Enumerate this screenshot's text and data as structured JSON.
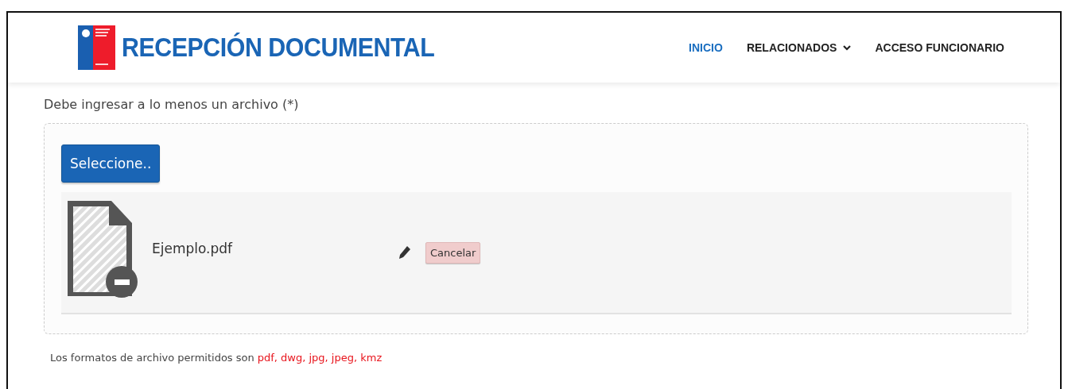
{
  "header": {
    "title": "RECEPCIÓN DOCUMENTAL",
    "nav": [
      {
        "label": "INICIO",
        "selected": true,
        "dropdown": false
      },
      {
        "label": "RELACIONADOS",
        "selected": false,
        "dropdown": true
      },
      {
        "label": "ACCESO FUNCIONARIO",
        "selected": false,
        "dropdown": false
      }
    ]
  },
  "upload": {
    "label": "Debe ingresar a lo menos un archivo (*)",
    "button": "Seleccione..",
    "files": [
      {
        "name": "Ejemplo.pdf",
        "cancel": "Cancelar"
      }
    ]
  },
  "note": {
    "text": "Los formatos de archivo permitidos son",
    "formats": "pdf, dwg, jpg, jpeg, kmz"
  }
}
